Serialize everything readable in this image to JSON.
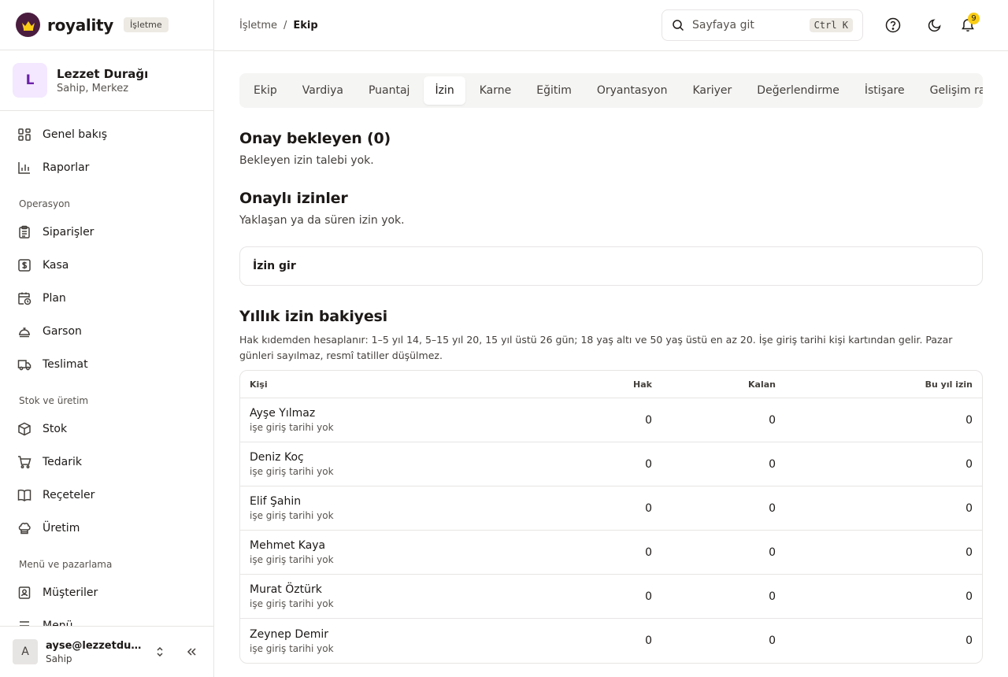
{
  "brand": {
    "name": "royality",
    "badge": "İşletme"
  },
  "business": {
    "initial": "L",
    "name": "Lezzet Durağı",
    "role": "Sahip, Merkez"
  },
  "sidebar": {
    "items_top": [
      {
        "label": "Genel bakış",
        "icon": "grid-icon"
      },
      {
        "label": "Raporlar",
        "icon": "bar-chart-icon"
      }
    ],
    "section_operasyon": "Operasyon",
    "items_operasyon": [
      {
        "label": "Siparişler",
        "icon": "clipboard-icon"
      },
      {
        "label": "Kasa",
        "icon": "dollar-icon"
      },
      {
        "label": "Plan",
        "icon": "calendar-clock-icon"
      },
      {
        "label": "Garson",
        "icon": "cloche-icon"
      },
      {
        "label": "Teslimat",
        "icon": "truck-icon"
      }
    ],
    "section_stok": "Stok ve üretim",
    "items_stok": [
      {
        "label": "Stok",
        "icon": "box-icon"
      },
      {
        "label": "Tedarik",
        "icon": "cart-icon"
      },
      {
        "label": "Reçeteler",
        "icon": "book-icon"
      },
      {
        "label": "Üretim",
        "icon": "chef-hat-icon"
      }
    ],
    "section_menu": "Menü ve pazarlama",
    "items_menu": [
      {
        "label": "Müşteriler",
        "icon": "contact-icon"
      },
      {
        "label": "Menü",
        "icon": "menu-icon"
      }
    ]
  },
  "user": {
    "initial": "A",
    "email": "ayse@lezzetduragi.com",
    "role": "Sahip"
  },
  "breadcrumb": {
    "parent": "İşletme",
    "sep": "/",
    "current": "Ekip"
  },
  "search": {
    "placeholder": "Sayfaya git",
    "shortcut": "Ctrl K"
  },
  "notifications": {
    "count": "9"
  },
  "tabs": [
    {
      "label": "Ekip",
      "active": false
    },
    {
      "label": "Vardiya",
      "active": false
    },
    {
      "label": "Puantaj",
      "active": false
    },
    {
      "label": "İzin",
      "active": true
    },
    {
      "label": "Karne",
      "active": false
    },
    {
      "label": "Eğitim",
      "active": false
    },
    {
      "label": "Oryantasyon",
      "active": false
    },
    {
      "label": "Kariyer",
      "active": false
    },
    {
      "label": "Değerlendirme",
      "active": false
    },
    {
      "label": "İstişare",
      "active": false
    },
    {
      "label": "Gelişim raporu",
      "active": false
    }
  ],
  "pending": {
    "title": "Onay bekleyen (0)",
    "empty": "Bekleyen izin talebi yok."
  },
  "approved": {
    "title": "Onaylı izinler",
    "empty": "Yaklaşan ya da süren izin yok."
  },
  "entry": {
    "label": "İzin gir"
  },
  "balance": {
    "title": "Yıllık izin bakiyesi",
    "note": "Hak kıdemden hesaplanır: 1–5 yıl 14, 5–15 yıl 20, 15 yıl üstü 26 gün; 18 yaş altı ve 50 yaş üstü en az 20. İşe giriş tarihi kişi kartından gelir. Pazar günleri sayılmaz, resmî tatiller düşülmez.",
    "columns": {
      "person": "Kişi",
      "entitlement": "Hak",
      "remaining": "Kalan",
      "this_year": "Bu yıl izin"
    },
    "rows": [
      {
        "name": "Ayşe Yılmaz",
        "sub": "işe giriş tarihi yok",
        "entitlement": "0",
        "remaining": "0",
        "this_year": "0"
      },
      {
        "name": "Deniz Koç",
        "sub": "işe giriş tarihi yok",
        "entitlement": "0",
        "remaining": "0",
        "this_year": "0"
      },
      {
        "name": "Elif Şahin",
        "sub": "işe giriş tarihi yok",
        "entitlement": "0",
        "remaining": "0",
        "this_year": "0"
      },
      {
        "name": "Mehmet Kaya",
        "sub": "işe giriş tarihi yok",
        "entitlement": "0",
        "remaining": "0",
        "this_year": "0"
      },
      {
        "name": "Murat Öztürk",
        "sub": "işe giriş tarihi yok",
        "entitlement": "0",
        "remaining": "0",
        "this_year": "0"
      },
      {
        "name": "Zeynep Demir",
        "sub": "işe giriş tarihi yok",
        "entitlement": "0",
        "remaining": "0",
        "this_year": "0"
      }
    ]
  },
  "colors": {
    "brand": "#4a1d3f",
    "accent_badge": "#facc15",
    "border": "#e7e5e4",
    "tab_bg": "#f5f5f4"
  }
}
